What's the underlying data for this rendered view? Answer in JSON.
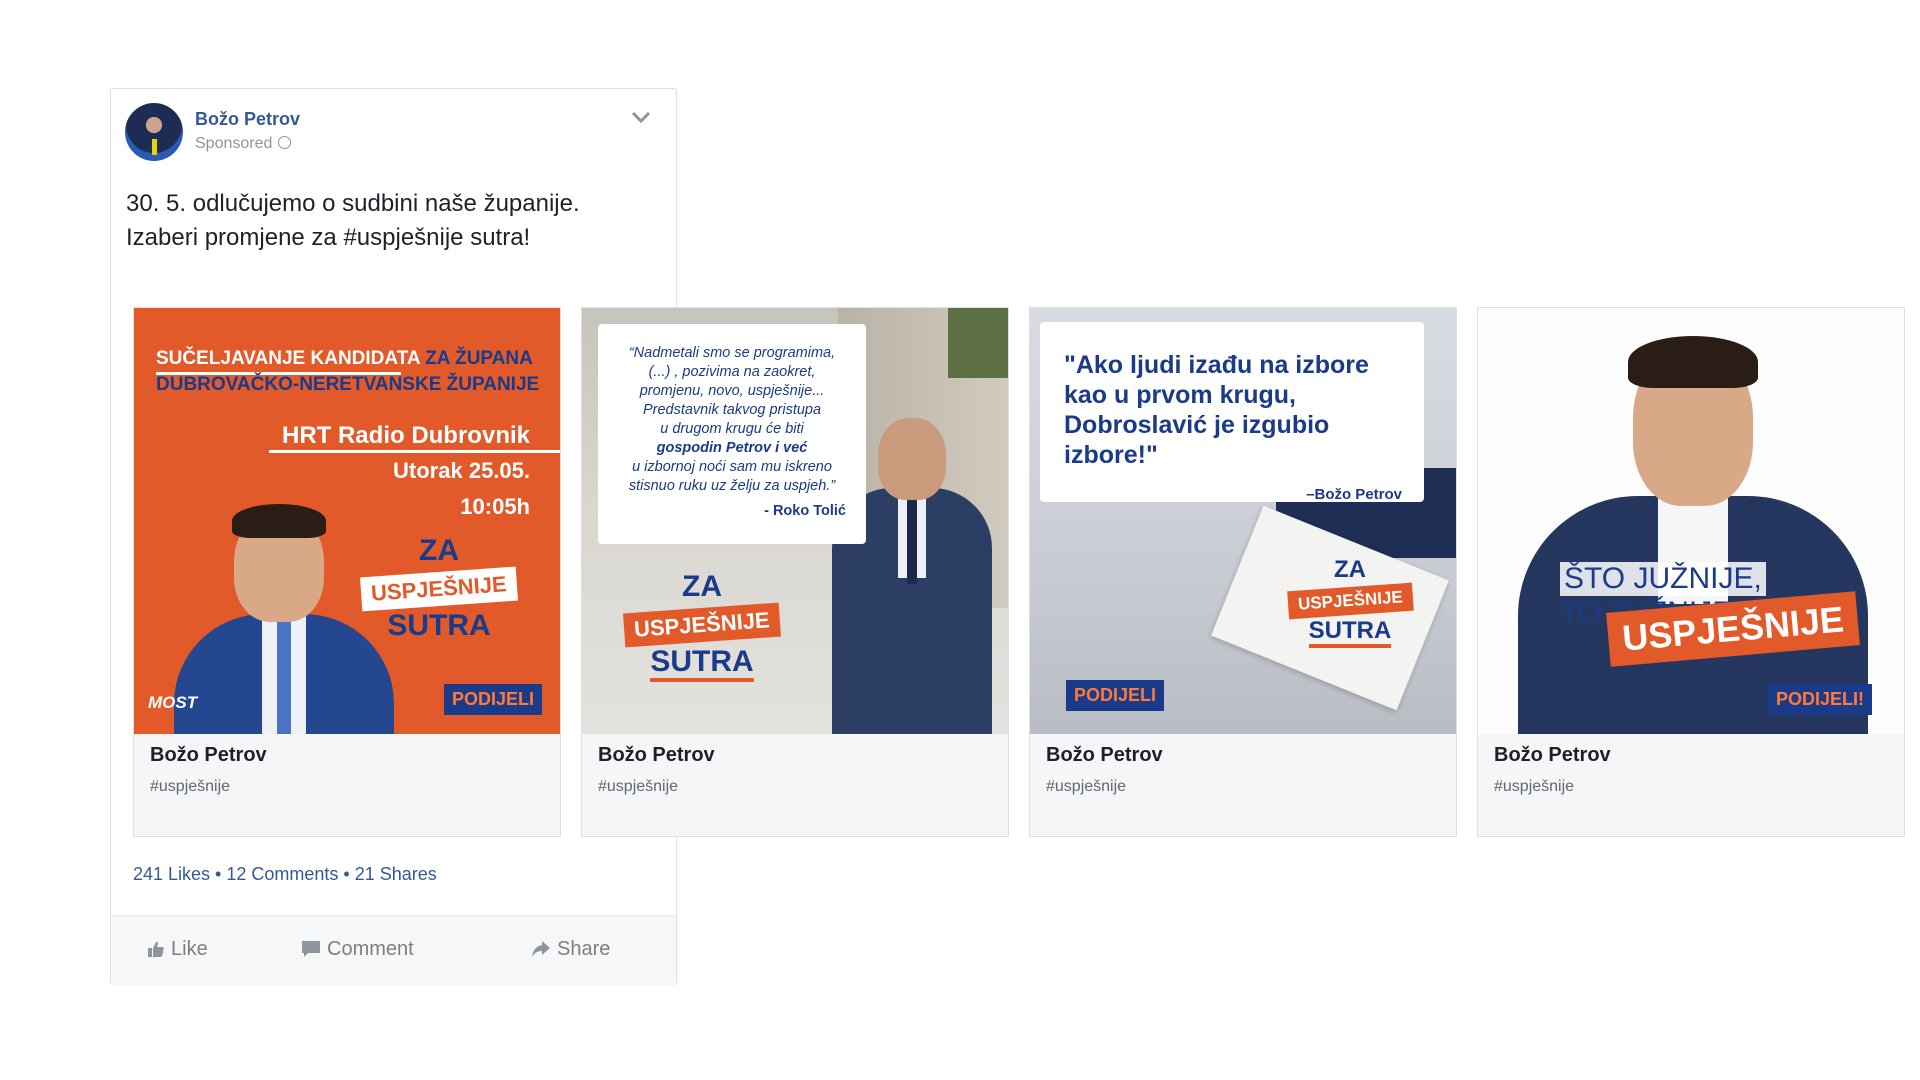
{
  "post": {
    "author": "Božo Petrov",
    "sponsored": "Sponsored",
    "text_lines": [
      "30. 5. odlučujemo o sudbini naše županije.",
      "Izaberi promjene za #uspješnije sutra!"
    ],
    "engagement": "241 Likes • 12 Comments • 21 Shares",
    "actions": {
      "like": "Like",
      "comment": "Comment",
      "share": "Share"
    }
  },
  "cards": [
    {
      "title": "Božo Petrov",
      "subtitle": "#uspješnije",
      "image": {
        "line1a": "SUČELJAVANJE KANDIDATA",
        "line1b": "ZA ŽUPANA",
        "line2": "DUBROVAČKO-NERETVANSKE ŽUPANIJE",
        "line3": "HRT Radio Dubrovnik",
        "line4": "Utorak 25.05.",
        "line5": "10:05h",
        "za": "ZA",
        "uspjesnije": "USPJEŠNIJE",
        "sutra": "SUTRA",
        "podijeli": "PODIJELI",
        "logo": "MOST"
      }
    },
    {
      "title": "Božo Petrov",
      "subtitle": "#uspješnije",
      "image": {
        "quote_lines": [
          "“Nadmetali smo se programima,",
          "(...) , pozivima na zaokret,",
          "promjenu, novo, uspješnije...",
          "Predstavnik takvog pristupa",
          "u drugom krugu će biti",
          "gospodin Petrov i već",
          "u izbornoj noći sam mu iskreno",
          "stisnuo ruku uz želju za uspjeh.”",
          "- Roko Tolić"
        ],
        "za": "ZA",
        "uspjesnije": "USPJEŠNIJE",
        "sutra": "SUTRA"
      }
    },
    {
      "title": "Božo Petrov",
      "subtitle": "#uspješnije",
      "image": {
        "quote_lines": [
          "\"Ako ljudi izađu na izbore",
          "kao u prvom krugu,",
          "Dobroslavić je izgubio",
          "izbore!\""
        ],
        "attribution": "–Božo Petrov",
        "za": "ZA",
        "uspjesnije": "USPJEŠNIJE",
        "sutra": "SUTRA",
        "podijeli": "PODIJELI"
      }
    },
    {
      "title": "Božo Petrov",
      "subtitle": "#uspješnije",
      "image": {
        "slogan1": "ŠTO JUŽNIJE,",
        "slogan2": "TO TUŽNIJE",
        "uspjesnije": "USPJEŠNIJE",
        "podijeli": "PODIJELI!"
      }
    }
  ],
  "colors": {
    "brand_orange": "#e35a2a",
    "brand_blue": "#1a3a8a",
    "link_blue": "#365899"
  }
}
